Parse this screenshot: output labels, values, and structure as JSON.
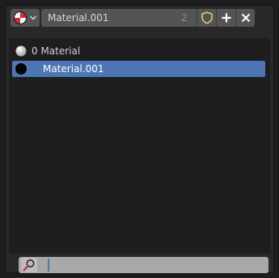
{
  "header": {
    "browse_icon": "material-sphere-icon",
    "chevron_icon": "chevron-down-icon",
    "datablock_name": "Material.001",
    "user_count": "2",
    "fake_user_icon": "shield-icon",
    "new_icon": "plus-icon",
    "unlink_icon": "close-icon"
  },
  "list": {
    "items": [
      {
        "label": "0 Material",
        "icon": "material-sphere-white-icon",
        "selected": false
      },
      {
        "label": "Material.001",
        "icon": "material-sphere-black-icon",
        "selected": true
      }
    ]
  },
  "search": {
    "icon": "magnifier-icon",
    "value": "",
    "placeholder": ""
  },
  "colors": {
    "accent": "#4d76b5",
    "panel_bg": "#282828",
    "list_bg": "#1e1e1e",
    "button_bg": "#545454",
    "fake_user_icon": "#e8d66b"
  }
}
